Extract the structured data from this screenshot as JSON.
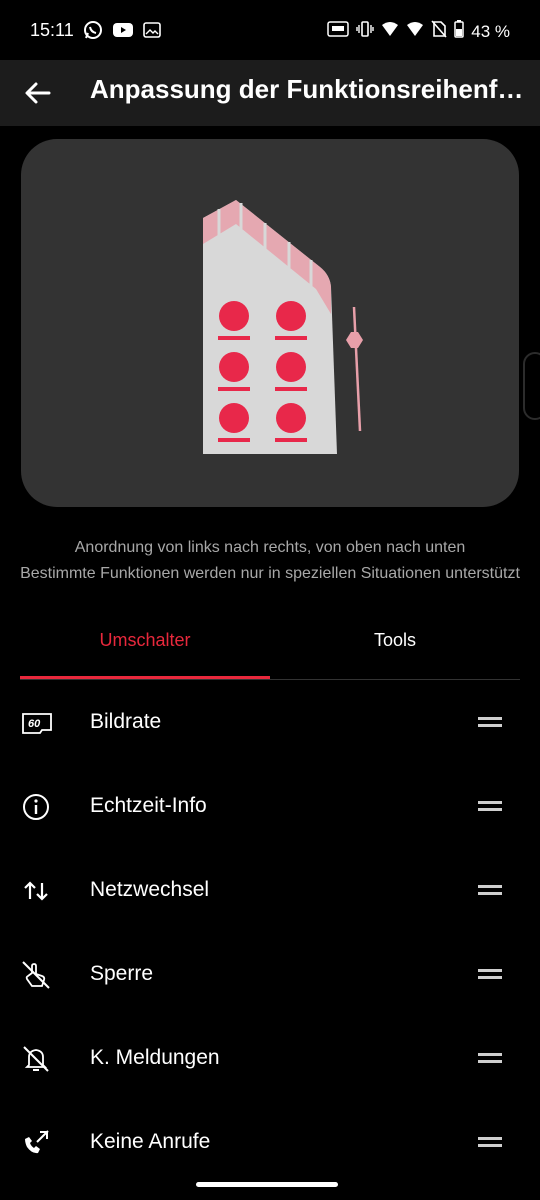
{
  "status_bar": {
    "time": "15:11",
    "battery_percent": "43 %",
    "left_icons": [
      "whatsapp-icon",
      "youtube-icon",
      "image-icon"
    ],
    "right_icons": [
      "refresh-rate-icon",
      "vibrate-icon",
      "wifi-icon",
      "signal-icon",
      "no-sim-icon",
      "battery-icon"
    ]
  },
  "app_bar": {
    "title": "Anpassung der Funktionsreihenfolge"
  },
  "description": {
    "line1": "Anordnung von links nach rechts, von oben nach unten",
    "line2": "Bestimmte Funktionen werden nur in speziellen Situationen unterstützt"
  },
  "tabs": [
    {
      "label": "Umschalter",
      "selected": true
    },
    {
      "label": "Tools",
      "selected": false
    }
  ],
  "items": [
    {
      "label": "Bildrate",
      "icon": "frame-rate-icon",
      "icon_text": "60"
    },
    {
      "label": "Echtzeit-Info",
      "icon": "info-icon"
    },
    {
      "label": "Netzwechsel",
      "icon": "network-switch-icon"
    },
    {
      "label": "Sperre",
      "icon": "touch-lock-icon"
    },
    {
      "label": "K. Meldungen",
      "icon": "notifications-off-icon"
    },
    {
      "label": "Keine Anrufe",
      "icon": "call-block-icon"
    }
  ],
  "colors": {
    "accent": "#e8283c",
    "background": "#000000",
    "illustration_bg": "#333333"
  }
}
